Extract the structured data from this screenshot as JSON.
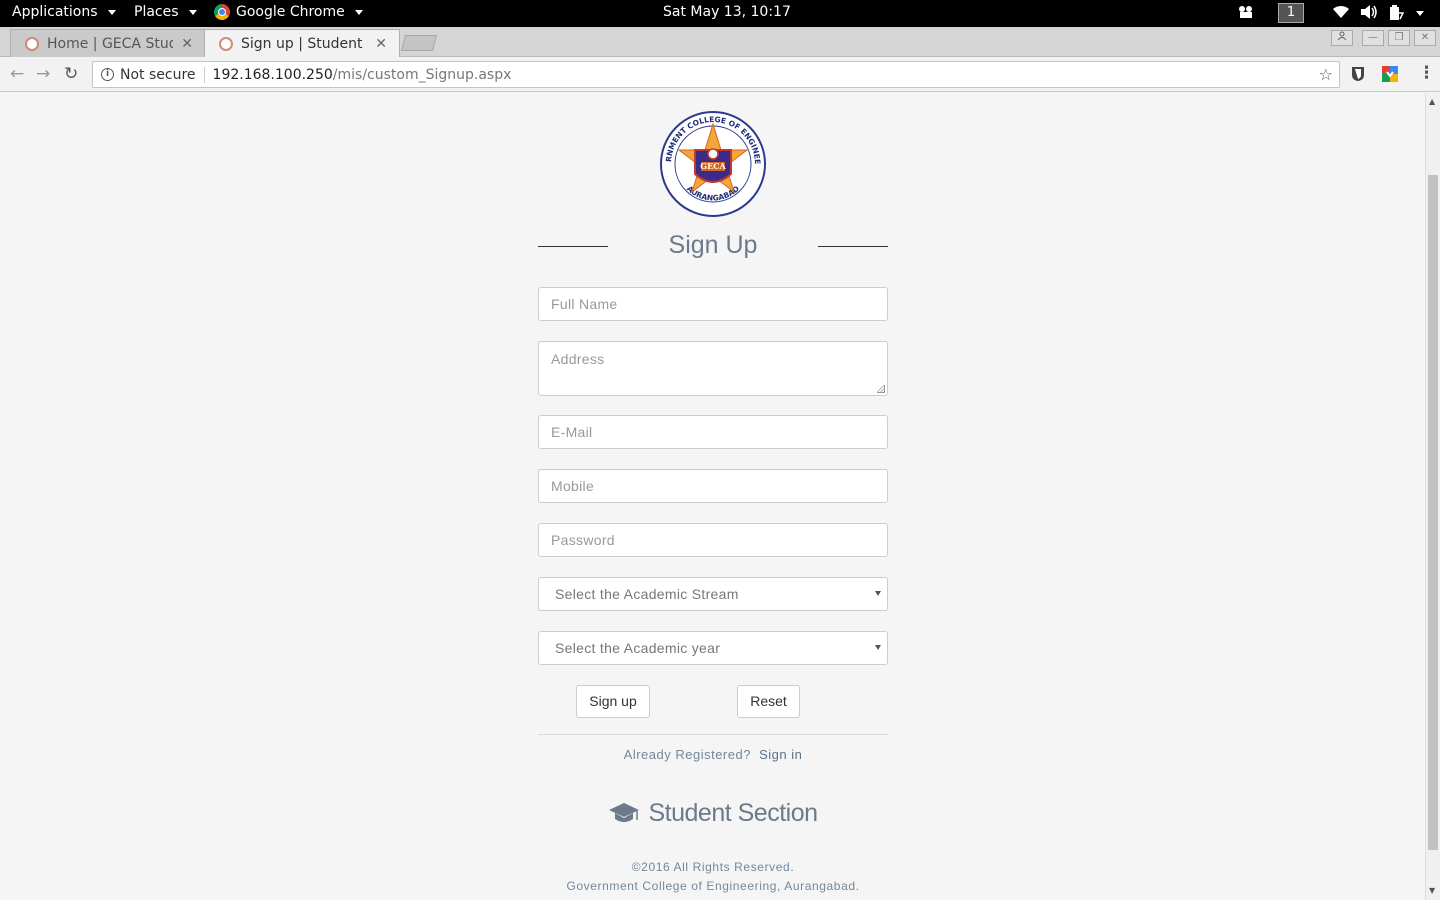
{
  "topbar": {
    "applications": "Applications",
    "places": "Places",
    "app_name": "Google Chrome",
    "clock": "Sat May 13, 10:17",
    "workspace": "1"
  },
  "tabs": [
    {
      "title": "Home | GECA Stude",
      "active": false
    },
    {
      "title": "Sign up | Student Se",
      "active": true
    }
  ],
  "omnibox": {
    "security": "Not secure",
    "host": "192.168.100.250",
    "path": "/mis/custom_Signup.aspx"
  },
  "logo": {
    "ring_text": "GOVERNMENT COLLEGE OF ENGINEERING",
    "city": "AURANGABAD",
    "badge": "GECA"
  },
  "form": {
    "title": "Sign Up",
    "full_name_placeholder": "Full Name",
    "address_placeholder": "Address",
    "email_placeholder": "E-Mail",
    "mobile_placeholder": "Mobile",
    "password_placeholder": "Password",
    "stream_select": "Select the Academic Stream",
    "year_select": "Select the Academic year",
    "signup_button": "Sign up",
    "reset_button": "Reset",
    "already_text": "Already Registered?",
    "signin_link": "Sign in"
  },
  "section": {
    "title": "Student Section",
    "icon": "graduation-cap-icon"
  },
  "footer": {
    "copyright": "©2016 All Rights Reserved.",
    "college": "Government College of Engineering, Aurangabad."
  },
  "colors": {
    "accent_text": "#6c7a8c",
    "link": "#5a738e"
  }
}
